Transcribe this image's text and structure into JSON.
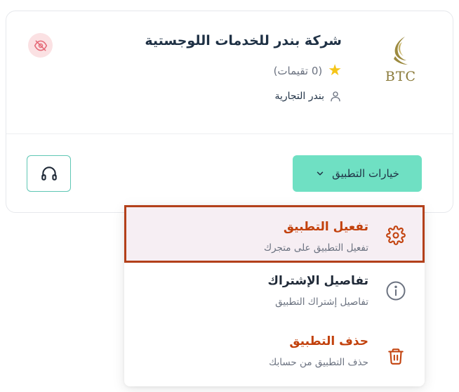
{
  "company": {
    "name": "شركة بندر للخدمات اللوجستية",
    "logo_text": "BTC",
    "rating_text": "(0 تقيمات)",
    "brand_name": "بندر التجارية"
  },
  "icons": {
    "hidden": "eye-off-icon",
    "support": "headphones-icon",
    "star": "star-icon",
    "user": "user-icon",
    "chevron": "chevron-down-icon",
    "activate": "gear-icon",
    "details": "info-icon",
    "delete": "trash-icon"
  },
  "actions": {
    "options_label": "خيارات التطبيق"
  },
  "menu": {
    "items": [
      {
        "title": "تفعيل التطبيق",
        "description": "تفعيل التطبيق على متجرك",
        "title_color": "#c2410c"
      },
      {
        "title": "تفاصيل الإشتراك",
        "description": "تفاصيل إشتراك التطبيق",
        "title_color": "#1f2937"
      },
      {
        "title": "حذف التطبيق",
        "description": "حذف التطبيق من حسابك",
        "title_color": "#c2410c"
      }
    ]
  },
  "colors": {
    "accent": "#6fe0c3",
    "danger": "#c2410c",
    "highlight_border": "#b3401a"
  }
}
